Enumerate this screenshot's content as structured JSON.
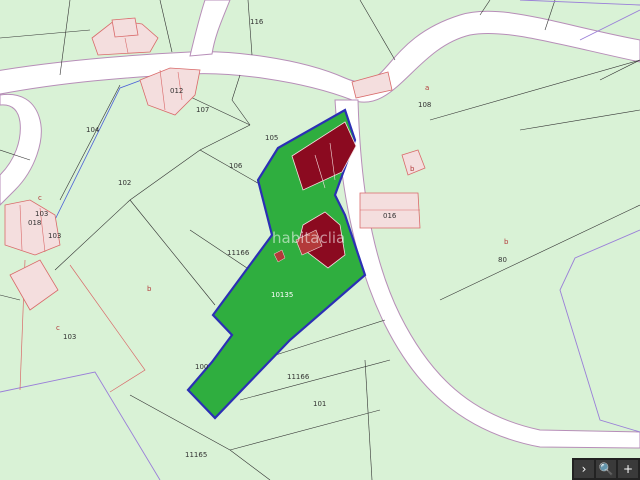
{
  "colors": {
    "parcel_fill": "#d9f2d6",
    "road_fill": "#ffffff",
    "road_edge": "#b78eb8",
    "parcel_line": "#333333",
    "boundary_purple": "#9a7fd8",
    "building_outline": "#d96a6a",
    "building_fill": "#f4dede",
    "selected_fill": "#2fae3f",
    "selected_border": "#2b2fb5",
    "selected_building": "#8b0a20",
    "toolbar_bg": "#222222"
  },
  "watermark": "habitaclia",
  "labels": {
    "p116": "116",
    "p012": "012",
    "p107": "107",
    "p108": "108",
    "p104": "104",
    "p105": "105",
    "p102": "102",
    "p106": "106",
    "p103a": "103",
    "p018": "018",
    "p103b": "103",
    "p11166a": "11166",
    "p10135": "10135",
    "p016": "016",
    "p80": "80",
    "p103c": "103",
    "p11166b": "11166",
    "p101": "101",
    "p100": "100",
    "p11165": "11165",
    "la": "a",
    "lb1": "b",
    "lb2": "b",
    "lb3": "b",
    "lc1": "c",
    "lc2": "c"
  },
  "toolbar": {
    "next": "›",
    "search": "🔍",
    "zoom_in": "+"
  }
}
